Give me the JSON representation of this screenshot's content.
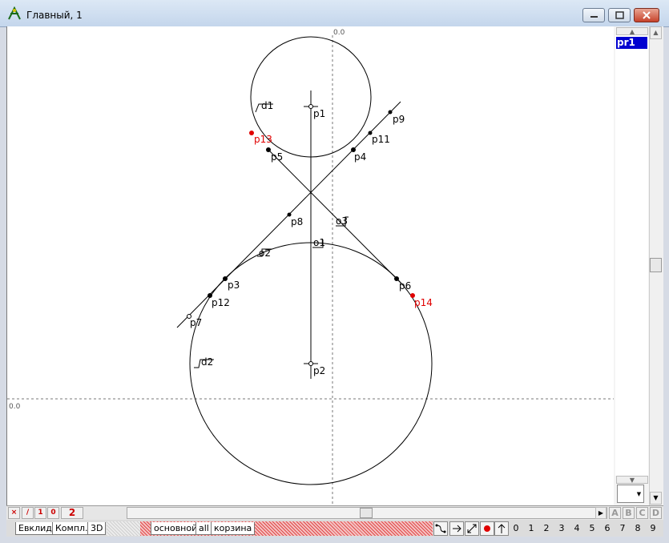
{
  "window": {
    "title": "Главный, 1"
  },
  "canvas": {
    "axis_label_top": "0.0",
    "axis_label_left": "0.0",
    "labels": {
      "d1": "d1",
      "d2": "d2",
      "p1": "p1",
      "p2": "p2",
      "p3": "p3",
      "p4": "p4",
      "p5": "p5",
      "p6": "p6",
      "p7": "p7",
      "p8": "p8",
      "p9": "p9",
      "p11": "p11",
      "p12": "p12",
      "p13": "p13",
      "p14": "p14",
      "o1": "o1",
      "o2": "o2",
      "o3": "o3"
    },
    "colors": {
      "normal_point": "#000000",
      "selected_point": "#e00000"
    }
  },
  "right_panel": {
    "list_items": [
      "pr1"
    ],
    "selected": "pr1"
  },
  "bottom_toolbar": {
    "tools": [
      "×",
      "/",
      "1",
      "0",
      "2"
    ],
    "letters": [
      "A",
      "B",
      "C",
      "D"
    ],
    "tabs_left": [
      "Евклид",
      "Компл.",
      "3D"
    ],
    "tabs_mid": [
      "основной",
      "all",
      "корзина"
    ],
    "digits": [
      "0",
      "1",
      "2",
      "3",
      "4",
      "5",
      "6",
      "7",
      "8",
      "9"
    ]
  }
}
